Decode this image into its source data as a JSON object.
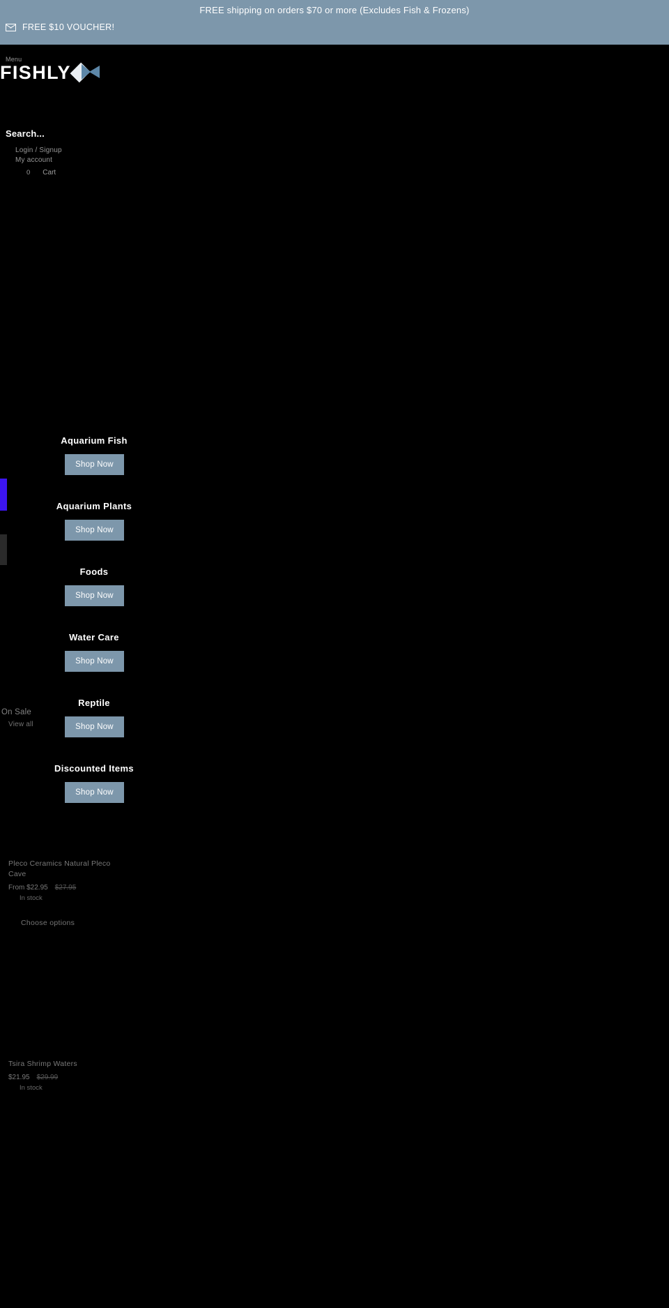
{
  "announcement": {
    "shipping_text": "FREE shipping on orders $70 or more (Excludes Fish & Frozens)",
    "voucher_text": "FREE $10 VOUCHER!",
    "mail_icon": "mail-icon",
    "bar_color": "#7d97ab"
  },
  "header": {
    "menu_label": "Menu",
    "logo_text": "FISHLY",
    "logo_icon": "fish-icon",
    "search_placeholder": "Search...",
    "account": {
      "login_signup": "Login / Signup",
      "my_account": "My account"
    },
    "cart": {
      "count": "0",
      "label": "Cart"
    }
  },
  "categories": [
    {
      "title": "Aquarium Fish",
      "cta": "Shop Now"
    },
    {
      "title": "Aquarium Plants",
      "cta": "Shop Now"
    },
    {
      "title": "Foods",
      "cta": "Shop Now"
    },
    {
      "title": "Water Care",
      "cta": "Shop Now"
    },
    {
      "title": "Reptile",
      "cta": "Shop Now"
    },
    {
      "title": "Discounted Items",
      "cta": "Shop Now"
    }
  ],
  "on_sale": {
    "heading": "On Sale",
    "view_all": "View all",
    "products": [
      {
        "title": "Pleco Ceramics Natural Pleco Cave",
        "price": "From $22.95",
        "compare_at": "$27.95",
        "stock": "In stock",
        "cta": "Choose options"
      },
      {
        "title": "Tsira Shrimp Waters",
        "price": "$21.95",
        "compare_at": "$29.99",
        "stock": "In stock",
        "cta": ""
      }
    ]
  },
  "accents": {
    "brand_blue": "#7d97ab",
    "sliver_blue": "#3c15f0",
    "sliver_gray": "#2a2a2a",
    "background": "#000000"
  }
}
